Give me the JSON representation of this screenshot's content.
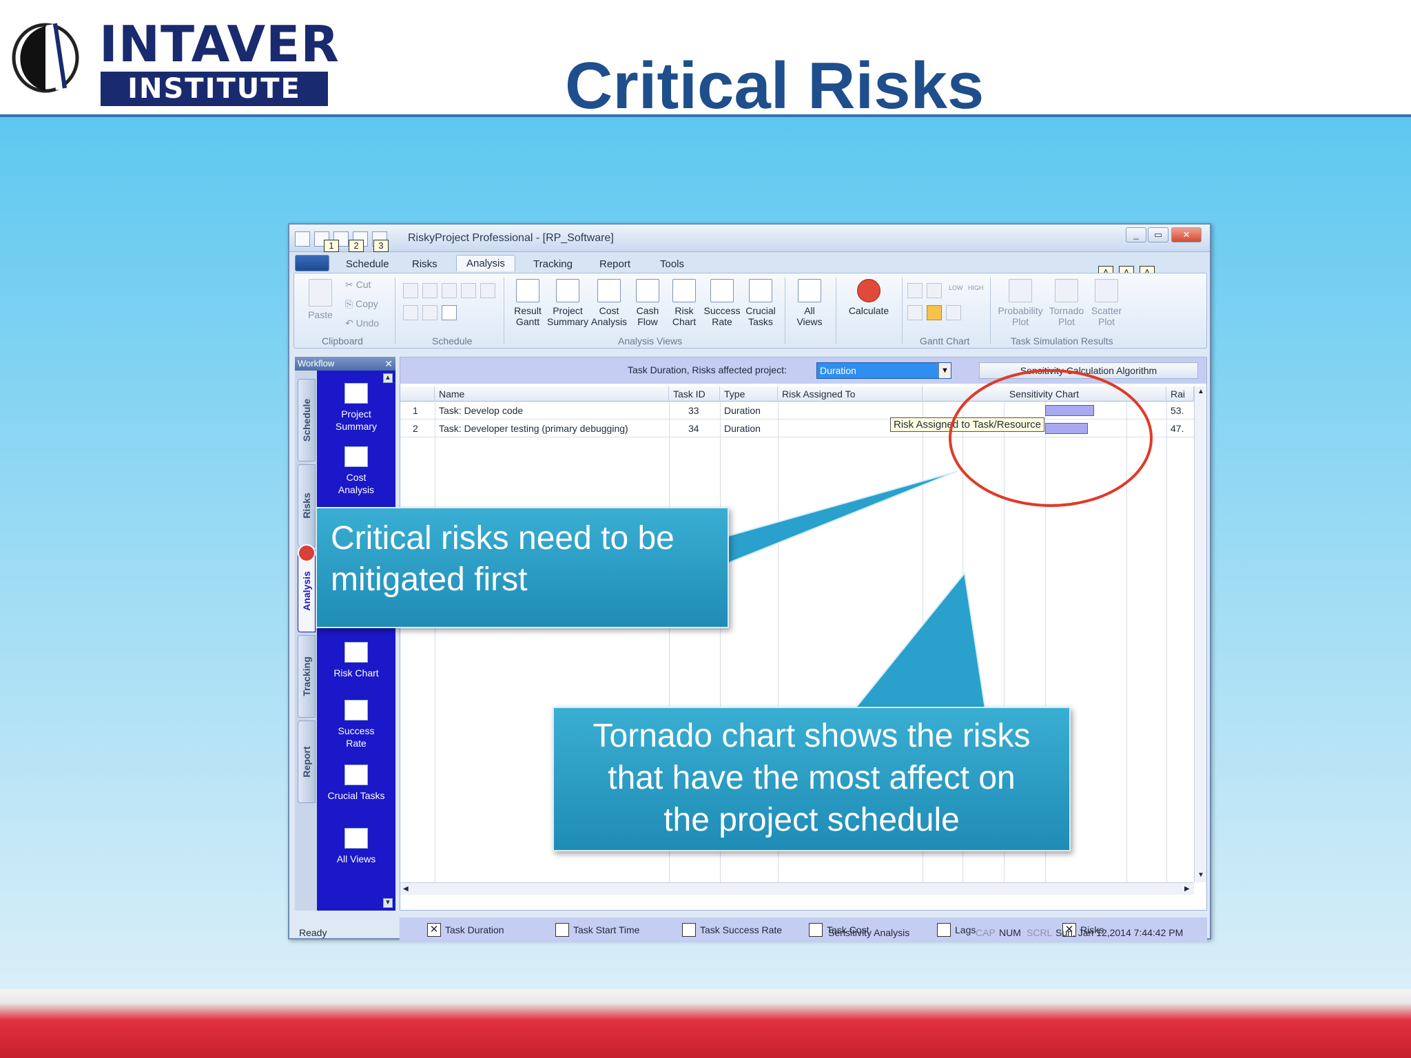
{
  "slide": {
    "logo_word1": "INTAVER",
    "logo_word2": "INSTITUTE",
    "title": "Critical Risks"
  },
  "window": {
    "title": "RiskyProject Professional - [RP_Software]",
    "qat_keytips": [
      "1",
      "2",
      "3"
    ],
    "controls": {
      "minimize": "_",
      "restore": "▭",
      "close": "✕"
    }
  },
  "ribbon": {
    "tabs": [
      "Schedule",
      "Risks",
      "Analysis",
      "Tracking",
      "Report",
      "Tools"
    ],
    "active_tab": "Analysis",
    "keytips": [
      "A",
      "A",
      "A"
    ],
    "clipboard": {
      "label": "Clipboard",
      "paste": "Paste",
      "cut": "Cut",
      "copy": "Copy",
      "undo": "Undo"
    },
    "schedule_group_label": "Schedule",
    "analysis_views": {
      "label": "Analysis Views",
      "buttons": [
        {
          "l1": "Result",
          "l2": "Gantt"
        },
        {
          "l1": "Project",
          "l2": "Summary"
        },
        {
          "l1": "Cost",
          "l2": "Analysis"
        },
        {
          "l1": "Cash",
          "l2": "Flow"
        },
        {
          "l1": "Risk",
          "l2": "Chart"
        },
        {
          "l1": "Success",
          "l2": "Rate"
        },
        {
          "l1": "Crucial",
          "l2": "Tasks"
        }
      ]
    },
    "all_views": {
      "l1": "All",
      "l2": "Views"
    },
    "calculate": "Calculate",
    "gantt_chart_label": "Gantt Chart",
    "gantt_small": {
      "low": "LOW",
      "high": "HIGH"
    },
    "task_sim": {
      "label": "Task Simulation Results",
      "buttons": [
        {
          "l1": "Probability",
          "l2": "Plot"
        },
        {
          "l1": "Tornado",
          "l2": "Plot"
        },
        {
          "l1": "Scatter",
          "l2": "Plot"
        }
      ]
    }
  },
  "workflow": {
    "header": "Workflow",
    "close": "✕",
    "tabs": [
      "Schedule",
      "Risks",
      "Analysis",
      "Tracking",
      "Report"
    ],
    "items": [
      {
        "l1": "Project",
        "l2": "Summary"
      },
      {
        "l1": "Cost",
        "l2": "Analysis"
      },
      {
        "l1": "Risk Chart",
        "l2": ""
      },
      {
        "l1": "Success",
        "l2": "Rate"
      },
      {
        "l1": "Crucial Tasks",
        "l2": ""
      },
      {
        "l1": "All Views",
        "l2": ""
      }
    ]
  },
  "view": {
    "filter_label": "Task Duration, Risks affected project:",
    "filter_value": "Duration",
    "algorithm_button": "Sensitivity Calculation Algorithm",
    "columns": [
      "Name",
      "Task ID",
      "Type",
      "Risk Assigned To",
      "Sensitivity Chart",
      "Rai"
    ],
    "rows": [
      {
        "num": "1",
        "name": "Task: Develop code",
        "task_id": "33",
        "type": "Duration",
        "risk_assigned": "",
        "sensitivity": 0.72,
        "rank": "53."
      },
      {
        "num": "2",
        "name": "Task: Developer testing (primary debugging)",
        "task_id": "34",
        "type": "Duration",
        "risk_assigned": "",
        "sensitivity": 0.63,
        "rank": "47."
      }
    ],
    "tooltip": "Risk Assigned to Task/Resource"
  },
  "checkboxes": [
    {
      "label": "Task Duration",
      "checked": true
    },
    {
      "label": "Task Start Time",
      "checked": false
    },
    {
      "label": "Task Success Rate",
      "checked": false
    },
    {
      "label": "Task Cost",
      "checked": false
    },
    {
      "label": "Lags",
      "checked": false
    },
    {
      "label": "Risks",
      "checked": true
    }
  ],
  "status": {
    "left": "Ready",
    "mode": "Sensitivity Analysis",
    "cap": "CAP",
    "num": "NUM",
    "scrl": "SCRL",
    "datetime": "Sun, Jan 12,2014  7:44:42 PM"
  },
  "callouts": {
    "c1_line1": "Critical risks need to be",
    "c1_line2": "mitigated first",
    "c2_line1": "Tornado chart shows the risks",
    "c2_line2": "that have the most affect on",
    "c2_line3": "the project schedule"
  },
  "colors": {
    "title": "#1f4e8c",
    "workflow": "#1a18c8",
    "callout": "#2a9ec8",
    "highlight_circle": "#e03a28"
  }
}
